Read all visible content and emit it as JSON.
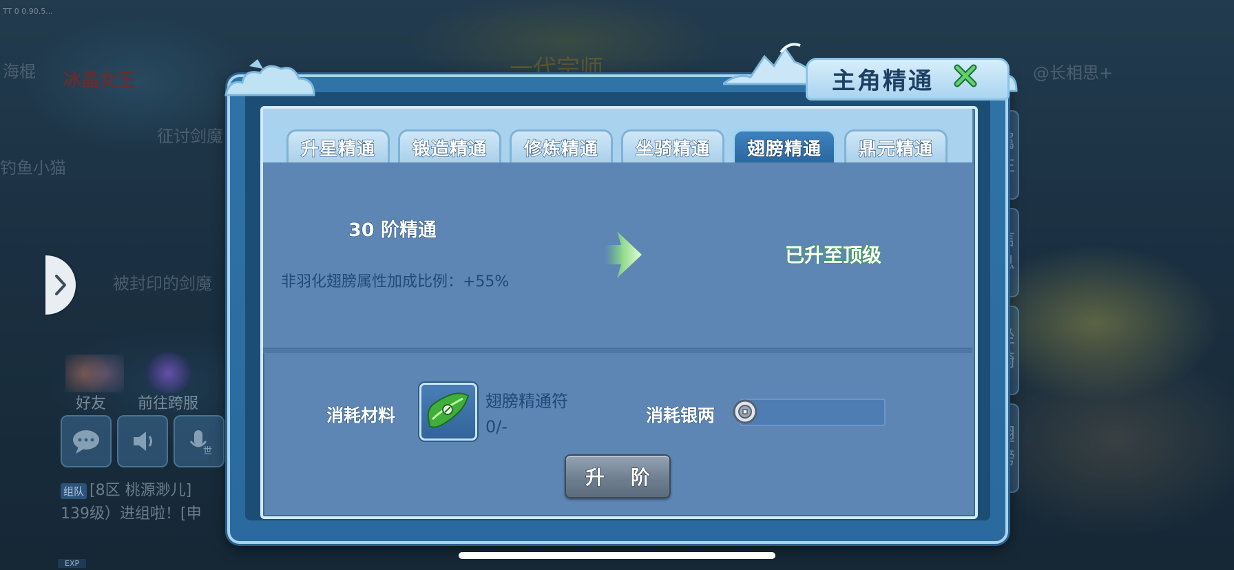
{
  "background": {
    "status_text": "TT 0 0.90.5...",
    "player_names": [
      "海棍",
      "冰晶女王",
      "征讨剑魔",
      "钓鱼小猫",
      "被封印的剑魔",
      "@长相思+"
    ],
    "banner_text": "一代宗师",
    "social": {
      "friends_label": "好友",
      "cross_server_label": "前往跨服"
    },
    "chat": {
      "team_tag": "组队",
      "line1": "[8区 桃源渺儿]",
      "line2": "139级）进组啦！[申",
      "voice_label": "世"
    },
    "exp_label": "EXP"
  },
  "side_tabs": [
    "属性",
    "信息",
    "坐骑",
    "翅膀"
  ],
  "dialog": {
    "title": "主角精通",
    "close_icon": "close-x-icon",
    "tabs": [
      {
        "label": "升星精通",
        "active": false
      },
      {
        "label": "锻造精通",
        "active": false
      },
      {
        "label": "修炼精通",
        "active": false
      },
      {
        "label": "坐骑精通",
        "active": false
      },
      {
        "label": "翅膀精通",
        "active": true
      },
      {
        "label": "鼎元精通",
        "active": false
      }
    ],
    "current": {
      "level_title": "30 阶精通",
      "bonus_text": "非羽化翅膀属性加成比例：+55%"
    },
    "next": {
      "status_text": "已升至顶级"
    },
    "cost": {
      "material_label": "消耗材料",
      "item_name": "翅膀精通符",
      "item_count": "0/-",
      "silver_label": "消耗银两",
      "silver_value": ""
    },
    "upgrade_button": "升 阶"
  },
  "colors": {
    "panel": "#5d86b5",
    "tab_active": "#2b66a0",
    "max_text_outline": "#3da23f"
  }
}
